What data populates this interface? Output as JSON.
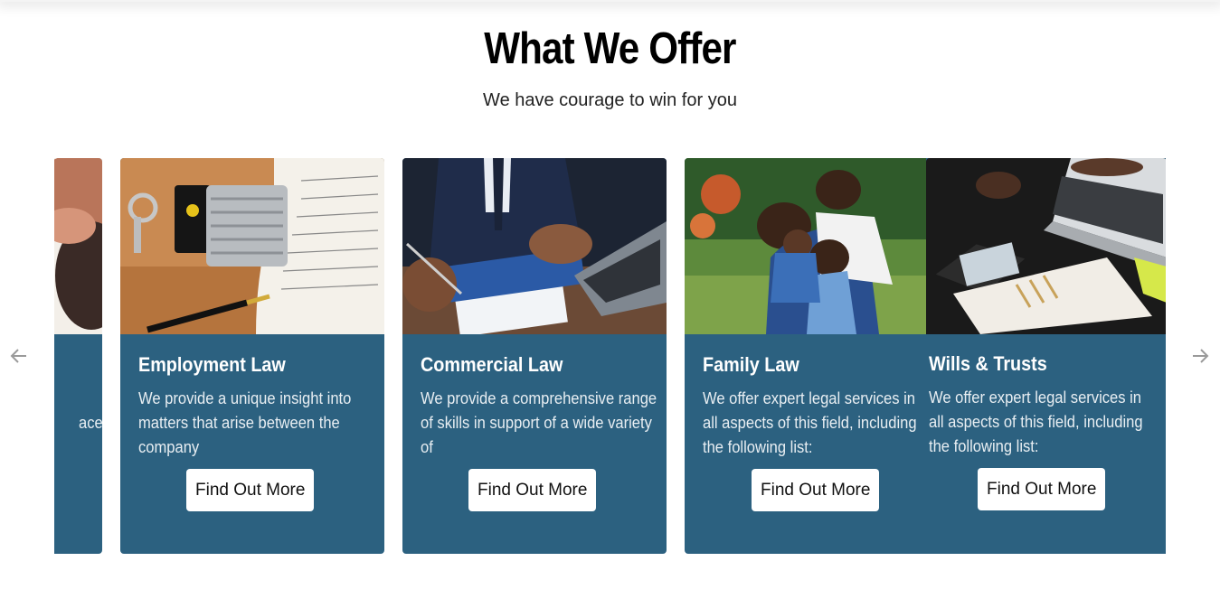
{
  "section": {
    "title": "What We Offer",
    "subtitle": "We have courage to win for you"
  },
  "carousel": {
    "prev_icon": "arrow-left-icon",
    "next_icon": "arrow-right-icon",
    "partial_card": {
      "desc_fragment": "ace"
    },
    "cards": [
      {
        "title": "Employment Law",
        "description": "We provide a unique insight into matters that arise between the company",
        "button": "Find Out More",
        "image": "padlock-on-book-photo"
      },
      {
        "title": "Commercial Law",
        "description": "We provide a comprehensive range of skills in support of a wide variety of",
        "button": "Find Out More",
        "image": "signing-document-photo"
      },
      {
        "title": "Family Law",
        "description": "We offer expert legal services in all aspects of this field, including the following list:",
        "button": "Find Out More",
        "image": "family-hug-photo"
      },
      {
        "title": "Wills & Trusts",
        "description": "We offer expert legal services in all aspects of this field, including the following list:",
        "button": "Find Out More",
        "image": "desk-laptop-planner-photo"
      }
    ]
  },
  "colors": {
    "card_bg": "#2c6180",
    "button_bg": "#ffffff",
    "arrow": "#9a9a9a"
  }
}
